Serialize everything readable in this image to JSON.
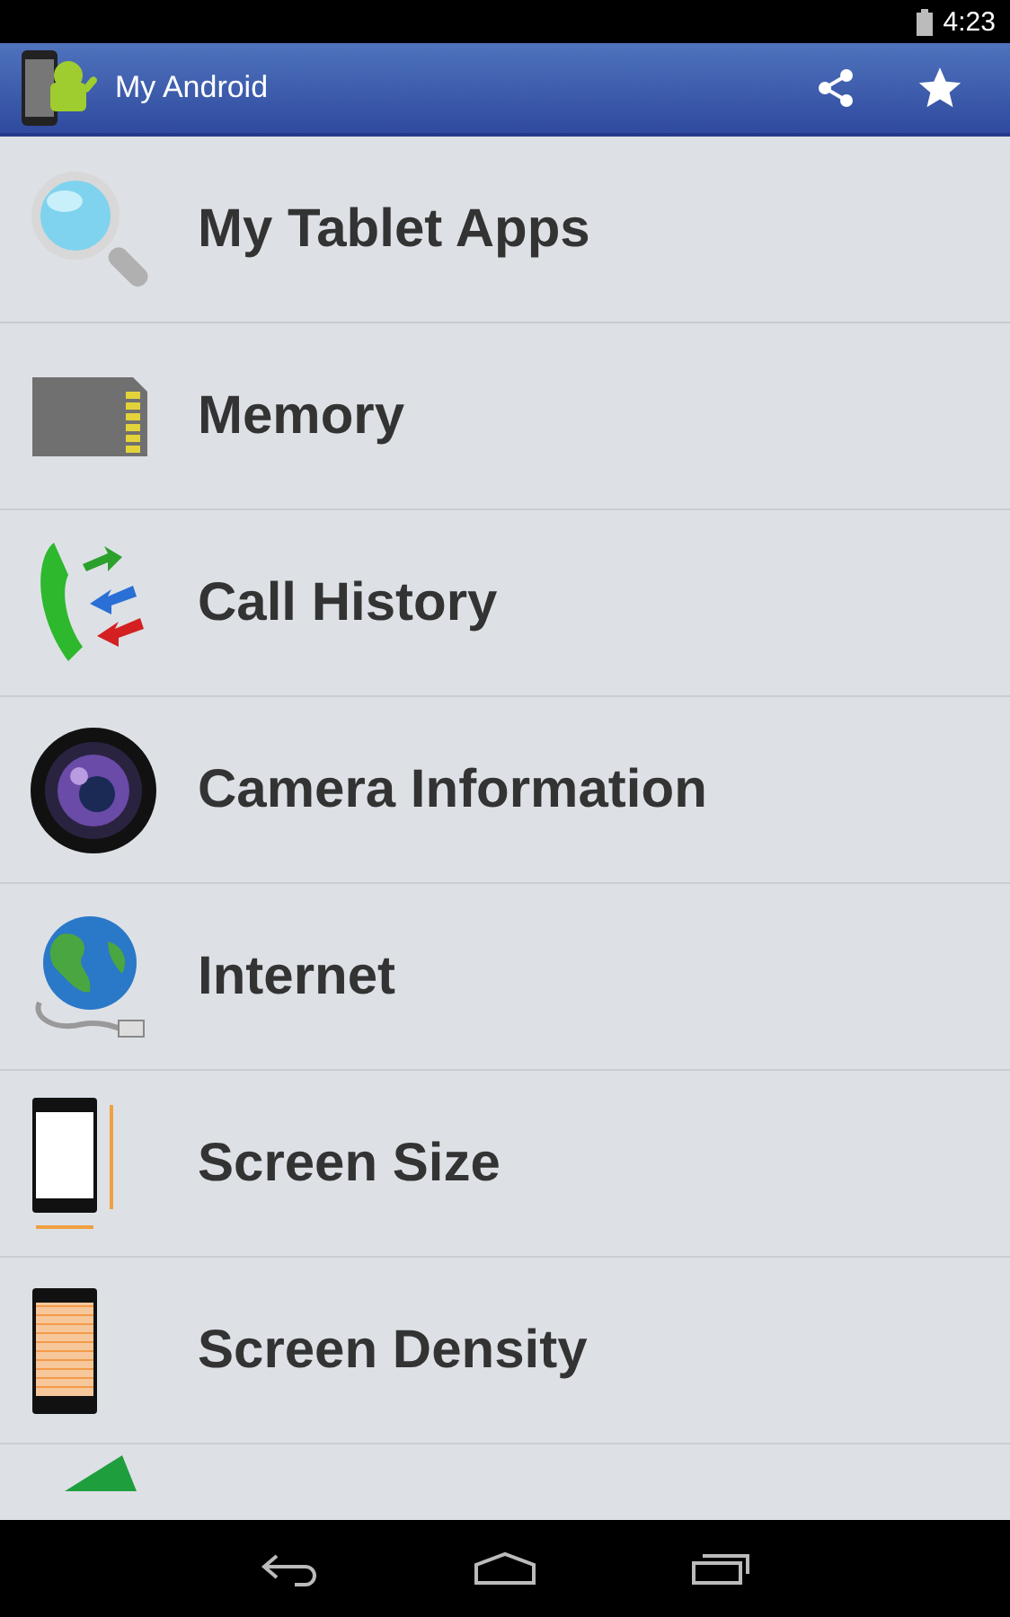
{
  "status_bar": {
    "time": "4:23"
  },
  "action_bar": {
    "title": "My Android",
    "actions": [
      {
        "kind": "share"
      },
      {
        "kind": "star"
      }
    ]
  },
  "menu": [
    {
      "label": "My Tablet Apps"
    },
    {
      "label": "Memory"
    },
    {
      "label": "Call History"
    },
    {
      "label": "Camera Information"
    },
    {
      "label": "Internet"
    },
    {
      "label": "Screen Size"
    },
    {
      "label": "Screen Density"
    }
  ],
  "nav_bar": [
    {
      "kind": "back"
    },
    {
      "kind": "home"
    },
    {
      "kind": "recents"
    }
  ]
}
